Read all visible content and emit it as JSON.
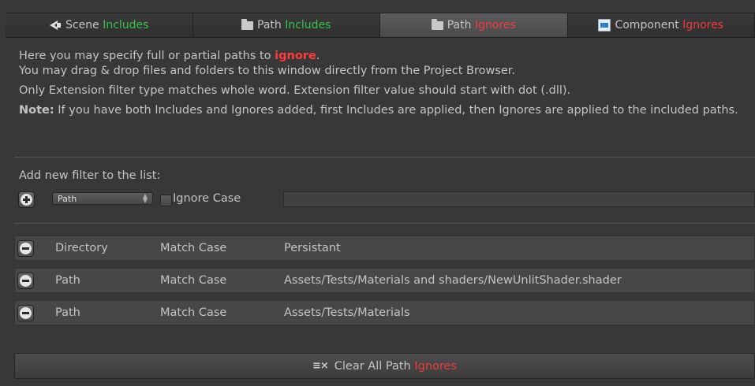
{
  "tabs": [
    {
      "icon": "scene-icon",
      "label": "Scene",
      "suffix": "Includes",
      "suffix_color": "green"
    },
    {
      "icon": "folder-icon",
      "label": "Path",
      "suffix": "Includes",
      "suffix_color": "green"
    },
    {
      "icon": "folder-icon",
      "label": "Path",
      "suffix": "Ignores",
      "suffix_color": "red",
      "active": true
    },
    {
      "icon": "component-icon",
      "label": "Component",
      "suffix": "Ignores",
      "suffix_color": "red"
    }
  ],
  "info": {
    "line1_prefix": "Here you may specify full or partial paths to ",
    "line1_emph": "ignore",
    "line1_suffix": ".",
    "line2": "You may drag & drop files and folders to this window directly from the Project Browser.",
    "line3": "Only Extension filter type matches whole word. Extension filter value should start with dot (.dll).",
    "note_label": "Note:",
    "note_text": " If you have both Includes and Ignores added, first Includes are applied, then Ignores are applied to the included paths."
  },
  "add_filter": {
    "label": "Add new filter to the list:",
    "type_selected": "Path",
    "ignore_case_label": "Ignore Case",
    "ignore_case_checked": false,
    "value": ""
  },
  "filters": [
    {
      "type": "Directory",
      "case": "Match Case",
      "value": "Persistant"
    },
    {
      "type": "Path",
      "case": "Match Case",
      "value": "Assets/Tests/Materials and shaders/NewUnlitShader.shader"
    },
    {
      "type": "Path",
      "case": "Match Case",
      "value": "Assets/Tests/Materials"
    }
  ],
  "clear_button": {
    "label": "Clear All Path",
    "emph": "Ignores"
  },
  "colors": {
    "green": "#37c24a",
    "red": "#f03a3a",
    "background": "#383838"
  }
}
